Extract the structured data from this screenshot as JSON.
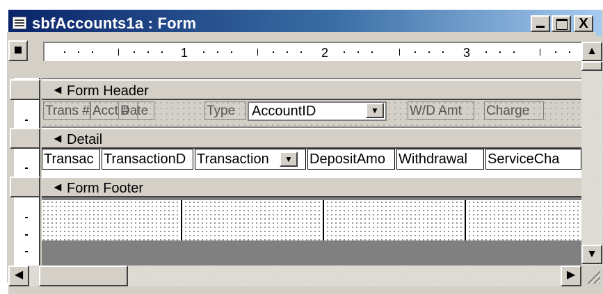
{
  "window": {
    "title": "sbfAccounts1a : Form",
    "controls": {
      "minimize": "_",
      "maximize": "□",
      "close": "X"
    }
  },
  "ruler": {
    "numbers": [
      "1",
      "2",
      "3"
    ]
  },
  "sections": {
    "form_header": "Form Header",
    "detail": "Detail",
    "form_footer": "Form Footer"
  },
  "header_controls": {
    "trans_label": "Trans #",
    "acct_label": "Acct #",
    "date_label": "Date",
    "type_label": "Type",
    "account_combo_value": "AccountID",
    "wd_amt_label": "W/D Amt",
    "charge_label": "Charge"
  },
  "detail_fields": [
    "Transac",
    "TransactionD",
    "Transaction",
    "DepositAmo",
    "Withdrawal",
    "ServiceCha"
  ],
  "icons": {
    "section_arrow": "section-collapse-icon",
    "form_icon": "form-icon"
  }
}
